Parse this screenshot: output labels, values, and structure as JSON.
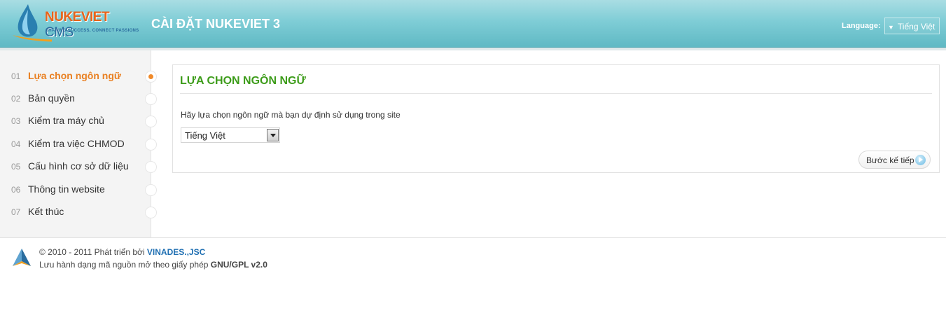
{
  "header": {
    "logo": {
      "brand": "NUKEVIET",
      "suffix": "CMS",
      "slogan": "SHARING SUCCESS, CONNECT PASSIONS"
    },
    "title": "CÀI ĐẶT NUKEVIET 3",
    "language_label": "Language:",
    "language_value": "Tiếng Việt"
  },
  "sidebar": {
    "steps": [
      {
        "num": "01",
        "label": "Lựa chọn ngôn ngữ",
        "active": true
      },
      {
        "num": "02",
        "label": "Bản quyền"
      },
      {
        "num": "03",
        "label": "Kiểm tra máy chủ"
      },
      {
        "num": "04",
        "label": "Kiểm tra việc CHMOD"
      },
      {
        "num": "05",
        "label": "Cấu hình cơ sở dữ liệu"
      },
      {
        "num": "06",
        "label": "Thông tin website"
      },
      {
        "num": "07",
        "label": "Kết thúc"
      }
    ]
  },
  "main": {
    "title": "LỰA CHỌN NGÔN NGỮ",
    "prompt": "Hãy lựa chọn ngôn ngữ mà bạn dự định sử dụng trong site",
    "select_value": "Tiếng Việt",
    "next_label": "Bước kế tiếp"
  },
  "footer": {
    "line1_prefix": "© 2010 - 2011 Phát triển bởi ",
    "line1_link": "VINADES.,JSC",
    "line2_prefix": "Lưu hành dạng mã nguồn mở theo giấy phép ",
    "line2_bold": "GNU/GPL v2.0"
  },
  "colors": {
    "header": "#7fcdd6",
    "active_step": "#e98022",
    "main_title": "#3d9c1a",
    "link": "#1f6fb2"
  }
}
